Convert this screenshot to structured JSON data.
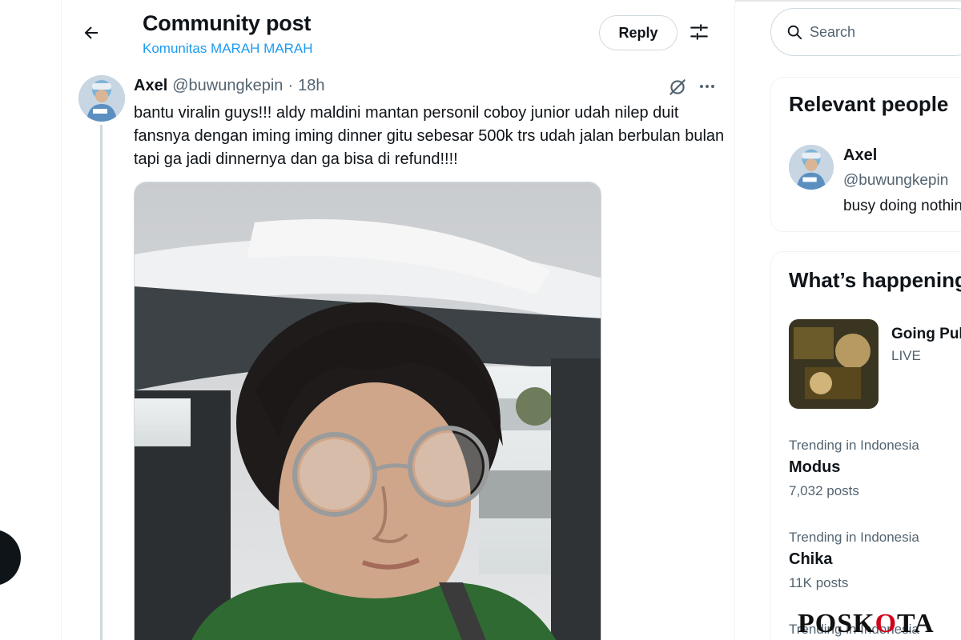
{
  "header": {
    "title": "Community post",
    "community": "Komunitas MARAH MARAH",
    "reply_label": "Reply"
  },
  "post": {
    "author_name": "Axel",
    "author_handle": "@buwungkepin",
    "separator": "·",
    "time": "18h",
    "text": "bantu viralin guys!!! aldy maldini mantan personil coboy junior udah nilep duit fansnya dengan iming iming dinner gitu sebesar 500k trs udah jalan berbulan bulan tapi ga jadi dinnernya dan ga bisa di refund!!!!"
  },
  "search": {
    "placeholder": "Search"
  },
  "relevant_people": {
    "title": "Relevant people",
    "people": [
      {
        "name": "Axel",
        "handle": "@buwungkepin",
        "bio": "busy doing nothing"
      }
    ]
  },
  "whats_happening": {
    "title": "What’s happening",
    "live": {
      "title": "Going Public",
      "label": "LIVE"
    },
    "trends": [
      {
        "context": "Trending in Indonesia",
        "name": "Modus",
        "count": "7,032 posts"
      },
      {
        "context": "Trending in Indonesia",
        "name": "Chika",
        "count": "11K posts"
      },
      {
        "context": "Trending in Indonesia",
        "name": "",
        "count": ""
      }
    ]
  },
  "watermark": {
    "prefix": "POSK",
    "accent": "O",
    "suffix": "TA"
  },
  "colors": {
    "accent": "#1d9bf0",
    "text_primary": "#0f1419",
    "text_secondary": "#536471",
    "border": "#cfd9de",
    "watermark_accent": "#d0021b"
  },
  "icons": [
    "arrow-left-icon",
    "sliders-icon",
    "grok-icon",
    "more-icon",
    "search-icon"
  ]
}
